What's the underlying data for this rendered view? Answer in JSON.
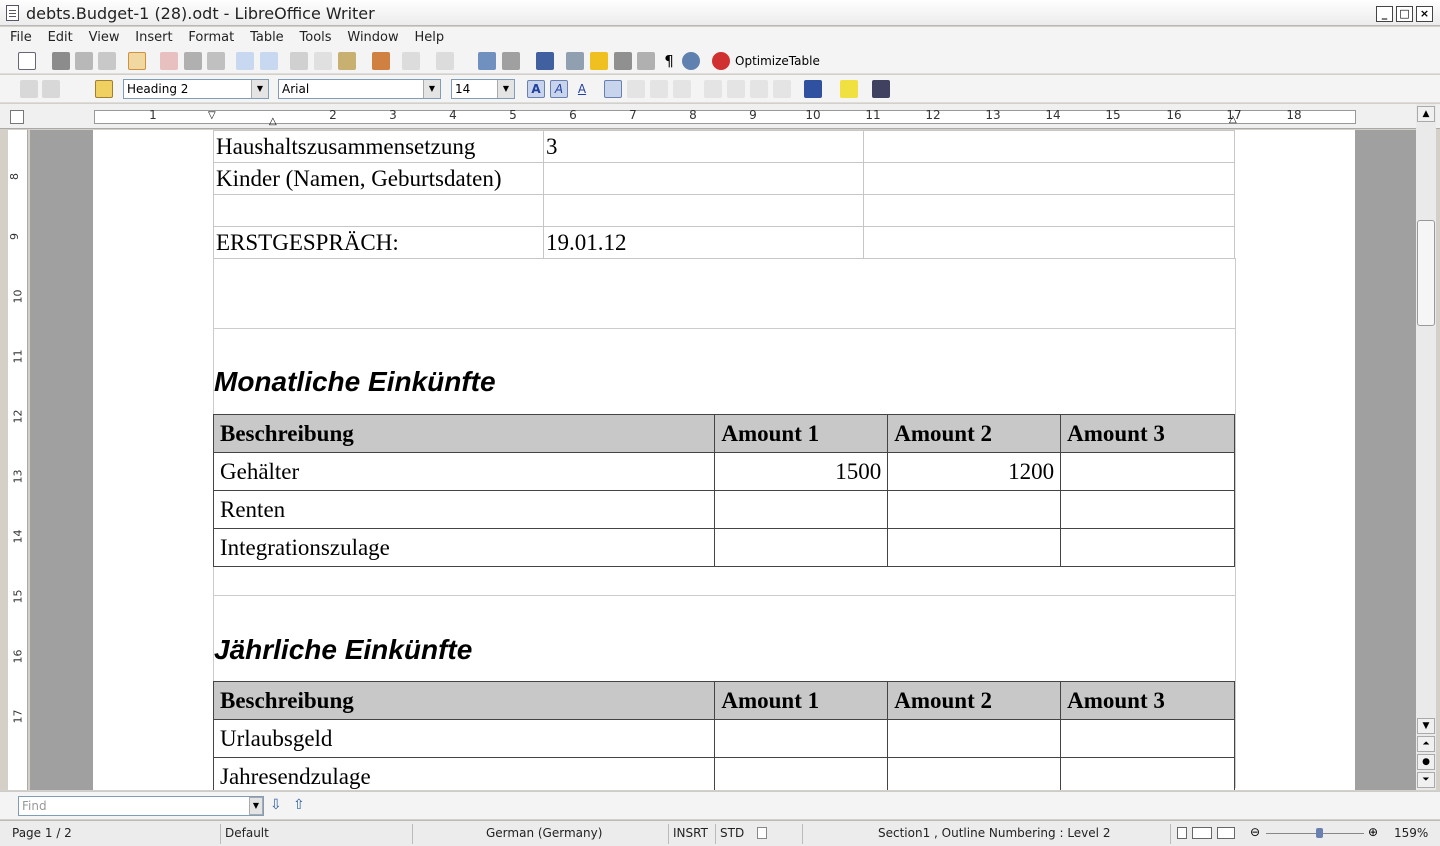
{
  "window": {
    "title": "debts.Budget-1 (28).odt - LibreOffice Writer"
  },
  "menu": [
    "File",
    "Edit",
    "View",
    "Insert",
    "Format",
    "Table",
    "Tools",
    "Window",
    "Help"
  ],
  "toolbar": {
    "optimize_label": "OptimizeTable"
  },
  "format_bar": {
    "style": "Heading 2",
    "font": "Arial",
    "size": "14"
  },
  "ruler": {
    "h_numbers": [
      "1",
      "2",
      "3",
      "4",
      "5",
      "6",
      "7",
      "8",
      "9",
      "10",
      "11",
      "12",
      "13",
      "14",
      "15",
      "16",
      "17",
      "18"
    ],
    "v_numbers": [
      "8",
      "9",
      "10",
      "11",
      "12",
      "13",
      "14",
      "15",
      "16",
      "17"
    ]
  },
  "info_table": [
    {
      "label": "Haushaltszusammensetzung",
      "value": "3"
    },
    {
      "label": "Kinder (Namen, Geburtsdaten)",
      "value": ""
    },
    {
      "label": "",
      "value": ""
    },
    {
      "label": "ERSTGESPRÄCH:",
      "value": "19.01.12"
    }
  ],
  "section1": {
    "heading": "Monatliche Einkünfte",
    "headers": [
      "Beschreibung",
      "Amount 1",
      "Amount 2",
      "Amount 3"
    ],
    "rows": [
      [
        "Gehälter",
        "1500",
        "1200",
        ""
      ],
      [
        "Renten",
        "",
        "",
        ""
      ],
      [
        "Integrationszulage",
        "",
        "",
        ""
      ]
    ]
  },
  "section2": {
    "heading": "Jährliche Einkünfte",
    "headers": [
      "Beschreibung",
      "Amount 1",
      "Amount 2",
      "Amount 3"
    ],
    "rows": [
      [
        "Urlaubsgeld",
        "",
        "",
        ""
      ],
      [
        "Jahresendzulage",
        "",
        "",
        ""
      ]
    ]
  },
  "find": {
    "placeholder": "Find"
  },
  "status": {
    "page": "Page 1 / 2",
    "style": "Default",
    "language": "German (Germany)",
    "insert_mode": "INSRT",
    "selection_mode": "STD",
    "section": "Section1 , Outline Numbering : Level 2",
    "zoom": "159%"
  },
  "colors": {
    "header_fill": "#c8c8c8",
    "workspace": "#a0a0a0"
  }
}
